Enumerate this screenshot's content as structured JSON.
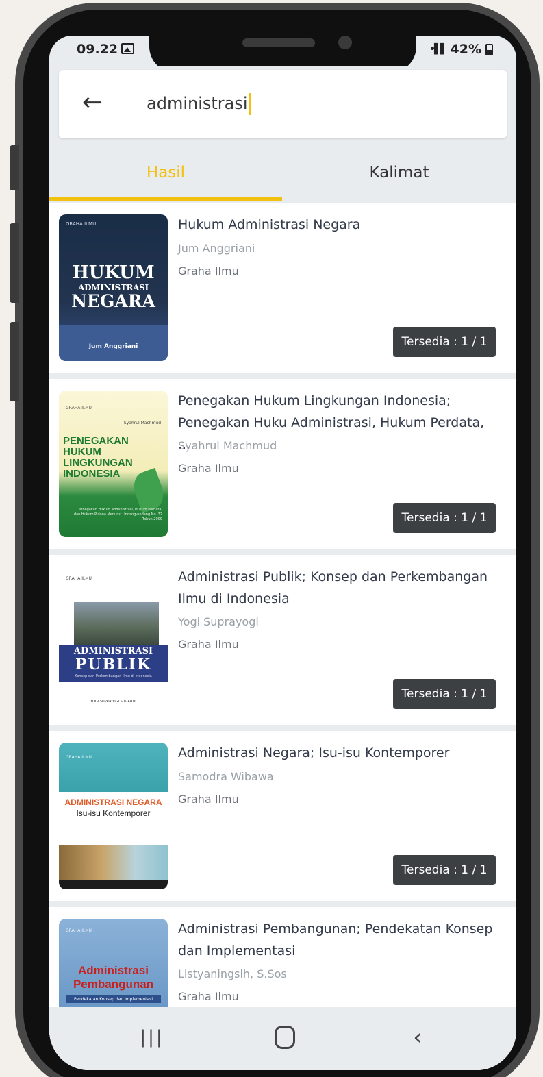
{
  "status": {
    "time": "09.22",
    "battery": "42%"
  },
  "search": {
    "query": "administrasi"
  },
  "tabs": [
    {
      "label": "Hasil",
      "active": true
    },
    {
      "label": "Kalimat",
      "active": false
    }
  ],
  "colors": {
    "accent": "#f2c10f",
    "badge_bg": "#3d4043",
    "surface": "#e9ecef"
  },
  "results": [
    {
      "title": "Hukum Administrasi Negara",
      "author": "Jum Anggriani",
      "publisher": "Graha Ilmu",
      "availability": "Tersedia : 1 / 1",
      "cover": {
        "publisher": "GRAHA ILMU",
        "line1": "HUKUM",
        "line2": "ADMINISTRASI",
        "line3": "NEGARA",
        "author": "Jum Anggriani"
      }
    },
    {
      "title": "Penegakan Hukum Lingkungan Indonesia; Penegakan Huku Administrasi, Hukum Perdata, ...",
      "author": "Syahrul Machmud",
      "publisher": "Graha Ilmu",
      "availability": "Tersedia : 1 / 1",
      "cover": {
        "publisher": "GRAHA ILMU",
        "author": "Syahrul Machmud",
        "line1": "PENEGAKAN",
        "line2": "HUKUM LINGKUNGAN",
        "line3": "INDONESIA",
        "small": "Penegakan Hukum Administrasi, Hukum Perdata, dan Hukum Pidana Menurut Undang-undang No. 32 Tahun 2009"
      }
    },
    {
      "title": "Administrasi Publik; Konsep dan Perkembangan Ilmu di Indonesia",
      "author": "Yogi Suprayogi",
      "publisher": "Graha Ilmu",
      "availability": "Tersedia : 1 / 1",
      "cover": {
        "publisher": "GRAHA ILMU",
        "line1": "ADMINISTRASI",
        "line2": "PUBLIK",
        "sub": "Konsep dan Perkembangan Ilmu di Indonesia",
        "author": "YOGI SUPRAYOGI SUGANDI"
      }
    },
    {
      "title": "Administrasi Negara; Isu-isu Kontemporer",
      "author": "Samodra Wibawa",
      "publisher": "Graha Ilmu",
      "availability": "Tersedia : 1 / 1",
      "cover": {
        "publisher": "GRAHA ILMU",
        "line1": "ADMINISTRASI NEGARA",
        "line2": "Isu-isu Kontemporer"
      }
    },
    {
      "title": "Administrasi Pembangunan; Pendekatan Konsep dan Implementasi",
      "author": "Listyaningsih, S.Sos",
      "publisher": "Graha Ilmu",
      "availability": "",
      "cover": {
        "publisher": "GRAHA ILMU",
        "line1": "Administrasi",
        "line2": "Pembangunan",
        "sub": "Pendekatan Konsep dan Implementasi"
      }
    }
  ],
  "nav": {
    "recent_icon": "recent-apps-icon",
    "home_icon": "home-icon",
    "back_icon": "back-icon"
  }
}
